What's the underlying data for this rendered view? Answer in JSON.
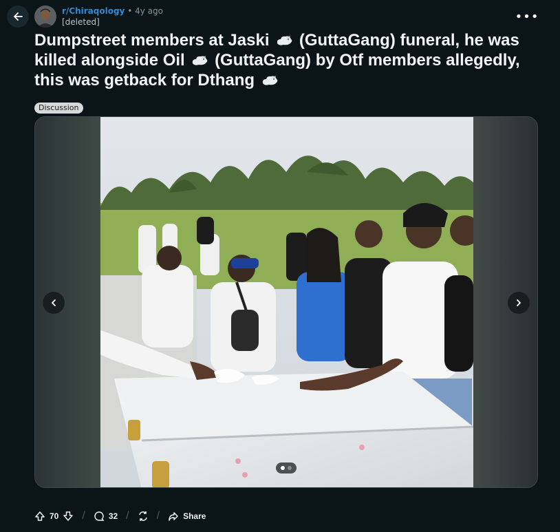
{
  "header": {
    "subreddit": "r/Chiraqology",
    "separator": "•",
    "age": "4y ago",
    "author": "[deleted]",
    "more_label": "•••"
  },
  "post": {
    "title_parts": [
      "Dumpstreet members at Jaski",
      "(GuttaGang) funeral, he was killed alongside Oil",
      "(GuttaGang) by Otf members allegedly, this was getback for Dthang",
      ""
    ],
    "flair": "Discussion"
  },
  "gallery": {
    "total_images": 2,
    "current_index": 1
  },
  "actions": {
    "votes": "70",
    "comments": "32",
    "share_label": "Share"
  },
  "icons": [
    "back-arrow-icon",
    "dove-emoji-icon",
    "chevron-left-icon",
    "chevron-right-icon",
    "upvote-icon",
    "downvote-icon",
    "comment-icon",
    "crosspost-icon",
    "share-icon"
  ]
}
